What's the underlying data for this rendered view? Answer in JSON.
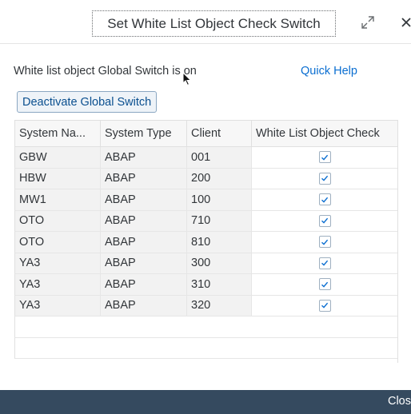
{
  "dialog": {
    "title": "Set White List Object Check Switch",
    "resize_icon": "resize-icon",
    "close_icon": "close-icon"
  },
  "status": {
    "message": "White list object Global Switch is on",
    "quick_help": "Quick Help"
  },
  "deactivate_label": "Deactivate Global Switch",
  "table": {
    "headers": [
      "System Na...",
      "System Type",
      "Client",
      "White List Object Check"
    ],
    "rows": [
      {
        "system": "GBW",
        "type": "ABAP",
        "client": "001",
        "checked": true
      },
      {
        "system": "HBW",
        "type": "ABAP",
        "client": "200",
        "checked": true
      },
      {
        "system": "MW1",
        "type": "ABAP",
        "client": "100",
        "checked": true
      },
      {
        "system": "OTO",
        "type": "ABAP",
        "client": "710",
        "checked": true
      },
      {
        "system": "OTO",
        "type": "ABAP",
        "client": "810",
        "checked": true
      },
      {
        "system": "YA3",
        "type": "ABAP",
        "client": "300",
        "checked": true
      },
      {
        "system": "YA3",
        "type": "ABAP",
        "client": "310",
        "checked": true
      },
      {
        "system": "YA3",
        "type": "ABAP",
        "client": "320",
        "checked": true
      }
    ]
  },
  "footer": {
    "close_label": "Clos"
  },
  "colors": {
    "link": "#0a6ed1",
    "footer_bg": "#354a5f",
    "checkbox_check": "#0a6ed1"
  }
}
